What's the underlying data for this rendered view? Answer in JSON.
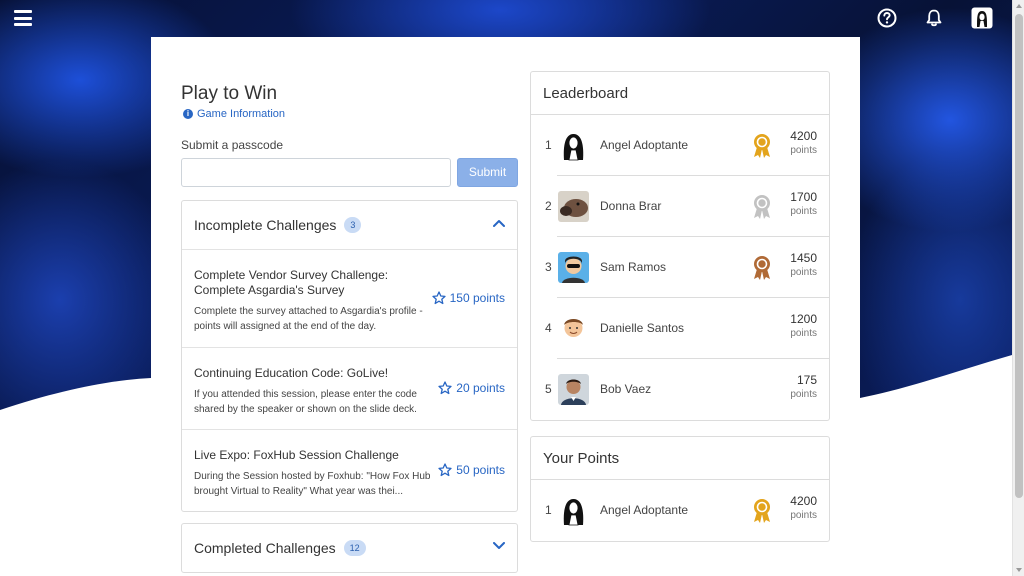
{
  "app": {
    "icons": [
      "menu-icon",
      "help-icon",
      "bell-icon",
      "avatar"
    ]
  },
  "page": {
    "title": "Play to Win",
    "game_info": "Game Information",
    "passcode_label": "Submit a passcode",
    "passcode_value": "",
    "submit_label": "Submit"
  },
  "incomplete": {
    "title": "Incomplete Challenges",
    "count": "3",
    "items": [
      {
        "title": "Complete Vendor Survey Challenge: Complete Asgardia's Survey",
        "desc": "Complete the survey attached to Asgardia's profile - points will assigned at the end of the day.",
        "points": "150 points"
      },
      {
        "title": "Continuing Education Code: GoLive!",
        "desc": "If you attended this session, please enter the code shared by the speaker or shown on the slide deck.",
        "points": "20 points"
      },
      {
        "title": "Live Expo: FoxHub Session Challenge",
        "desc": "During the Session hosted by Foxhub: \"How Fox Hub brought Virtual to Reality\" What year was thei...",
        "points": "50 points"
      }
    ]
  },
  "completed": {
    "title": "Completed Challenges",
    "count": "12"
  },
  "leaderboard": {
    "title": "Leaderboard",
    "unit": "points",
    "rows": [
      {
        "rank": "1",
        "name": "Angel Adoptante",
        "points": "4200",
        "medal": "gold"
      },
      {
        "rank": "2",
        "name": "Donna Brar",
        "points": "1700",
        "medal": "silver"
      },
      {
        "rank": "3",
        "name": "Sam Ramos",
        "points": "1450",
        "medal": "bronze"
      },
      {
        "rank": "4",
        "name": "Danielle Santos",
        "points": "1200",
        "medal": ""
      },
      {
        "rank": "5",
        "name": "Bob Vaez",
        "points": "175",
        "medal": ""
      }
    ]
  },
  "your_points": {
    "title": "Your Points",
    "rank": "1",
    "name": "Angel Adoptante",
    "points": "4200",
    "unit": "points",
    "medal": "gold"
  },
  "colors": {
    "accent": "#2866c4",
    "submit": "#8bb0e8",
    "gold": "#e3a41c",
    "silver": "#c2c2c2",
    "bronze": "#b06a36"
  }
}
